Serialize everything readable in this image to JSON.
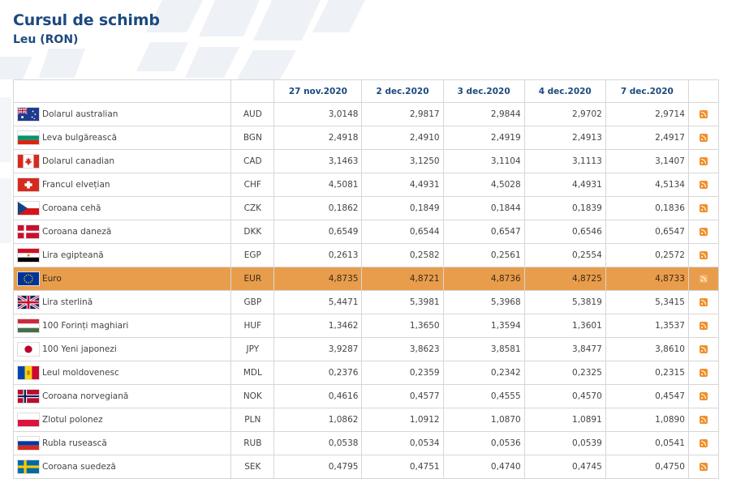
{
  "page": {
    "title": "Cursul de schimb",
    "subtitle": "Leu (RON)"
  },
  "table": {
    "dates": [
      "27 nov.2020",
      "2 dec.2020",
      "3 dec.2020",
      "4 dec.2020",
      "7 dec.2020"
    ],
    "rows": [
      {
        "flag": "AU",
        "name": "Dolarul australian",
        "code": "AUD",
        "values": [
          "3,0148",
          "2,9817",
          "2,9844",
          "2,9702",
          "2,9714"
        ]
      },
      {
        "flag": "BG",
        "name": "Leva bulgărească",
        "code": "BGN",
        "values": [
          "2,4918",
          "2,4910",
          "2,4919",
          "2,4913",
          "2,4917"
        ]
      },
      {
        "flag": "CA",
        "name": "Dolarul canadian",
        "code": "CAD",
        "values": [
          "3,1463",
          "3,1250",
          "3,1104",
          "3,1113",
          "3,1407"
        ]
      },
      {
        "flag": "CH",
        "name": "Francul elvețian",
        "code": "CHF",
        "values": [
          "4,5081",
          "4,4931",
          "4,5028",
          "4,4931",
          "4,5134"
        ]
      },
      {
        "flag": "CZ",
        "name": "Coroana cehă",
        "code": "CZK",
        "values": [
          "0,1862",
          "0,1849",
          "0,1844",
          "0,1839",
          "0,1836"
        ]
      },
      {
        "flag": "DK",
        "name": "Coroana daneză",
        "code": "DKK",
        "values": [
          "0,6549",
          "0,6544",
          "0,6547",
          "0,6546",
          "0,6547"
        ]
      },
      {
        "flag": "EG",
        "name": "Lira egipteană",
        "code": "EGP",
        "values": [
          "0,2613",
          "0,2582",
          "0,2561",
          "0,2554",
          "0,2572"
        ]
      },
      {
        "flag": "EU",
        "name": "Euro",
        "code": "EUR",
        "values": [
          "4,8735",
          "4,8721",
          "4,8736",
          "4,8725",
          "4,8733"
        ],
        "highlight": true
      },
      {
        "flag": "GB",
        "name": "Lira sterlină",
        "code": "GBP",
        "values": [
          "5,4471",
          "5,3981",
          "5,3968",
          "5,3819",
          "5,3415"
        ]
      },
      {
        "flag": "HU",
        "name": "100 Forinți maghiari",
        "code": "HUF",
        "values": [
          "1,3462",
          "1,3650",
          "1,3594",
          "1,3601",
          "1,3537"
        ]
      },
      {
        "flag": "JP",
        "name": "100 Yeni japonezi",
        "code": "JPY",
        "values": [
          "3,9287",
          "3,8623",
          "3,8581",
          "3,8477",
          "3,8610"
        ]
      },
      {
        "flag": "MD",
        "name": "Leul moldovenesc",
        "code": "MDL",
        "values": [
          "0,2376",
          "0,2359",
          "0,2342",
          "0,2325",
          "0,2315"
        ]
      },
      {
        "flag": "NO",
        "name": "Coroana norvegiană",
        "code": "NOK",
        "values": [
          "0,4616",
          "0,4577",
          "0,4555",
          "0,4570",
          "0,4547"
        ]
      },
      {
        "flag": "PL",
        "name": "Zlotul polonez",
        "code": "PLN",
        "values": [
          "1,0862",
          "1,0912",
          "1,0870",
          "1,0891",
          "1,0890"
        ]
      },
      {
        "flag": "RU",
        "name": "Rubla rusească",
        "code": "RUB",
        "values": [
          "0,0538",
          "0,0534",
          "0,0536",
          "0,0539",
          "0,0541"
        ]
      },
      {
        "flag": "SE",
        "name": "Coroana suedeză",
        "code": "SEK",
        "values": [
          "0,4795",
          "0,4751",
          "0,4740",
          "0,4745",
          "0,4750"
        ]
      }
    ]
  },
  "colors": {
    "heading": "#1c4a7e",
    "highlight_row": "#e89d4c",
    "rss": "#f0902a"
  }
}
